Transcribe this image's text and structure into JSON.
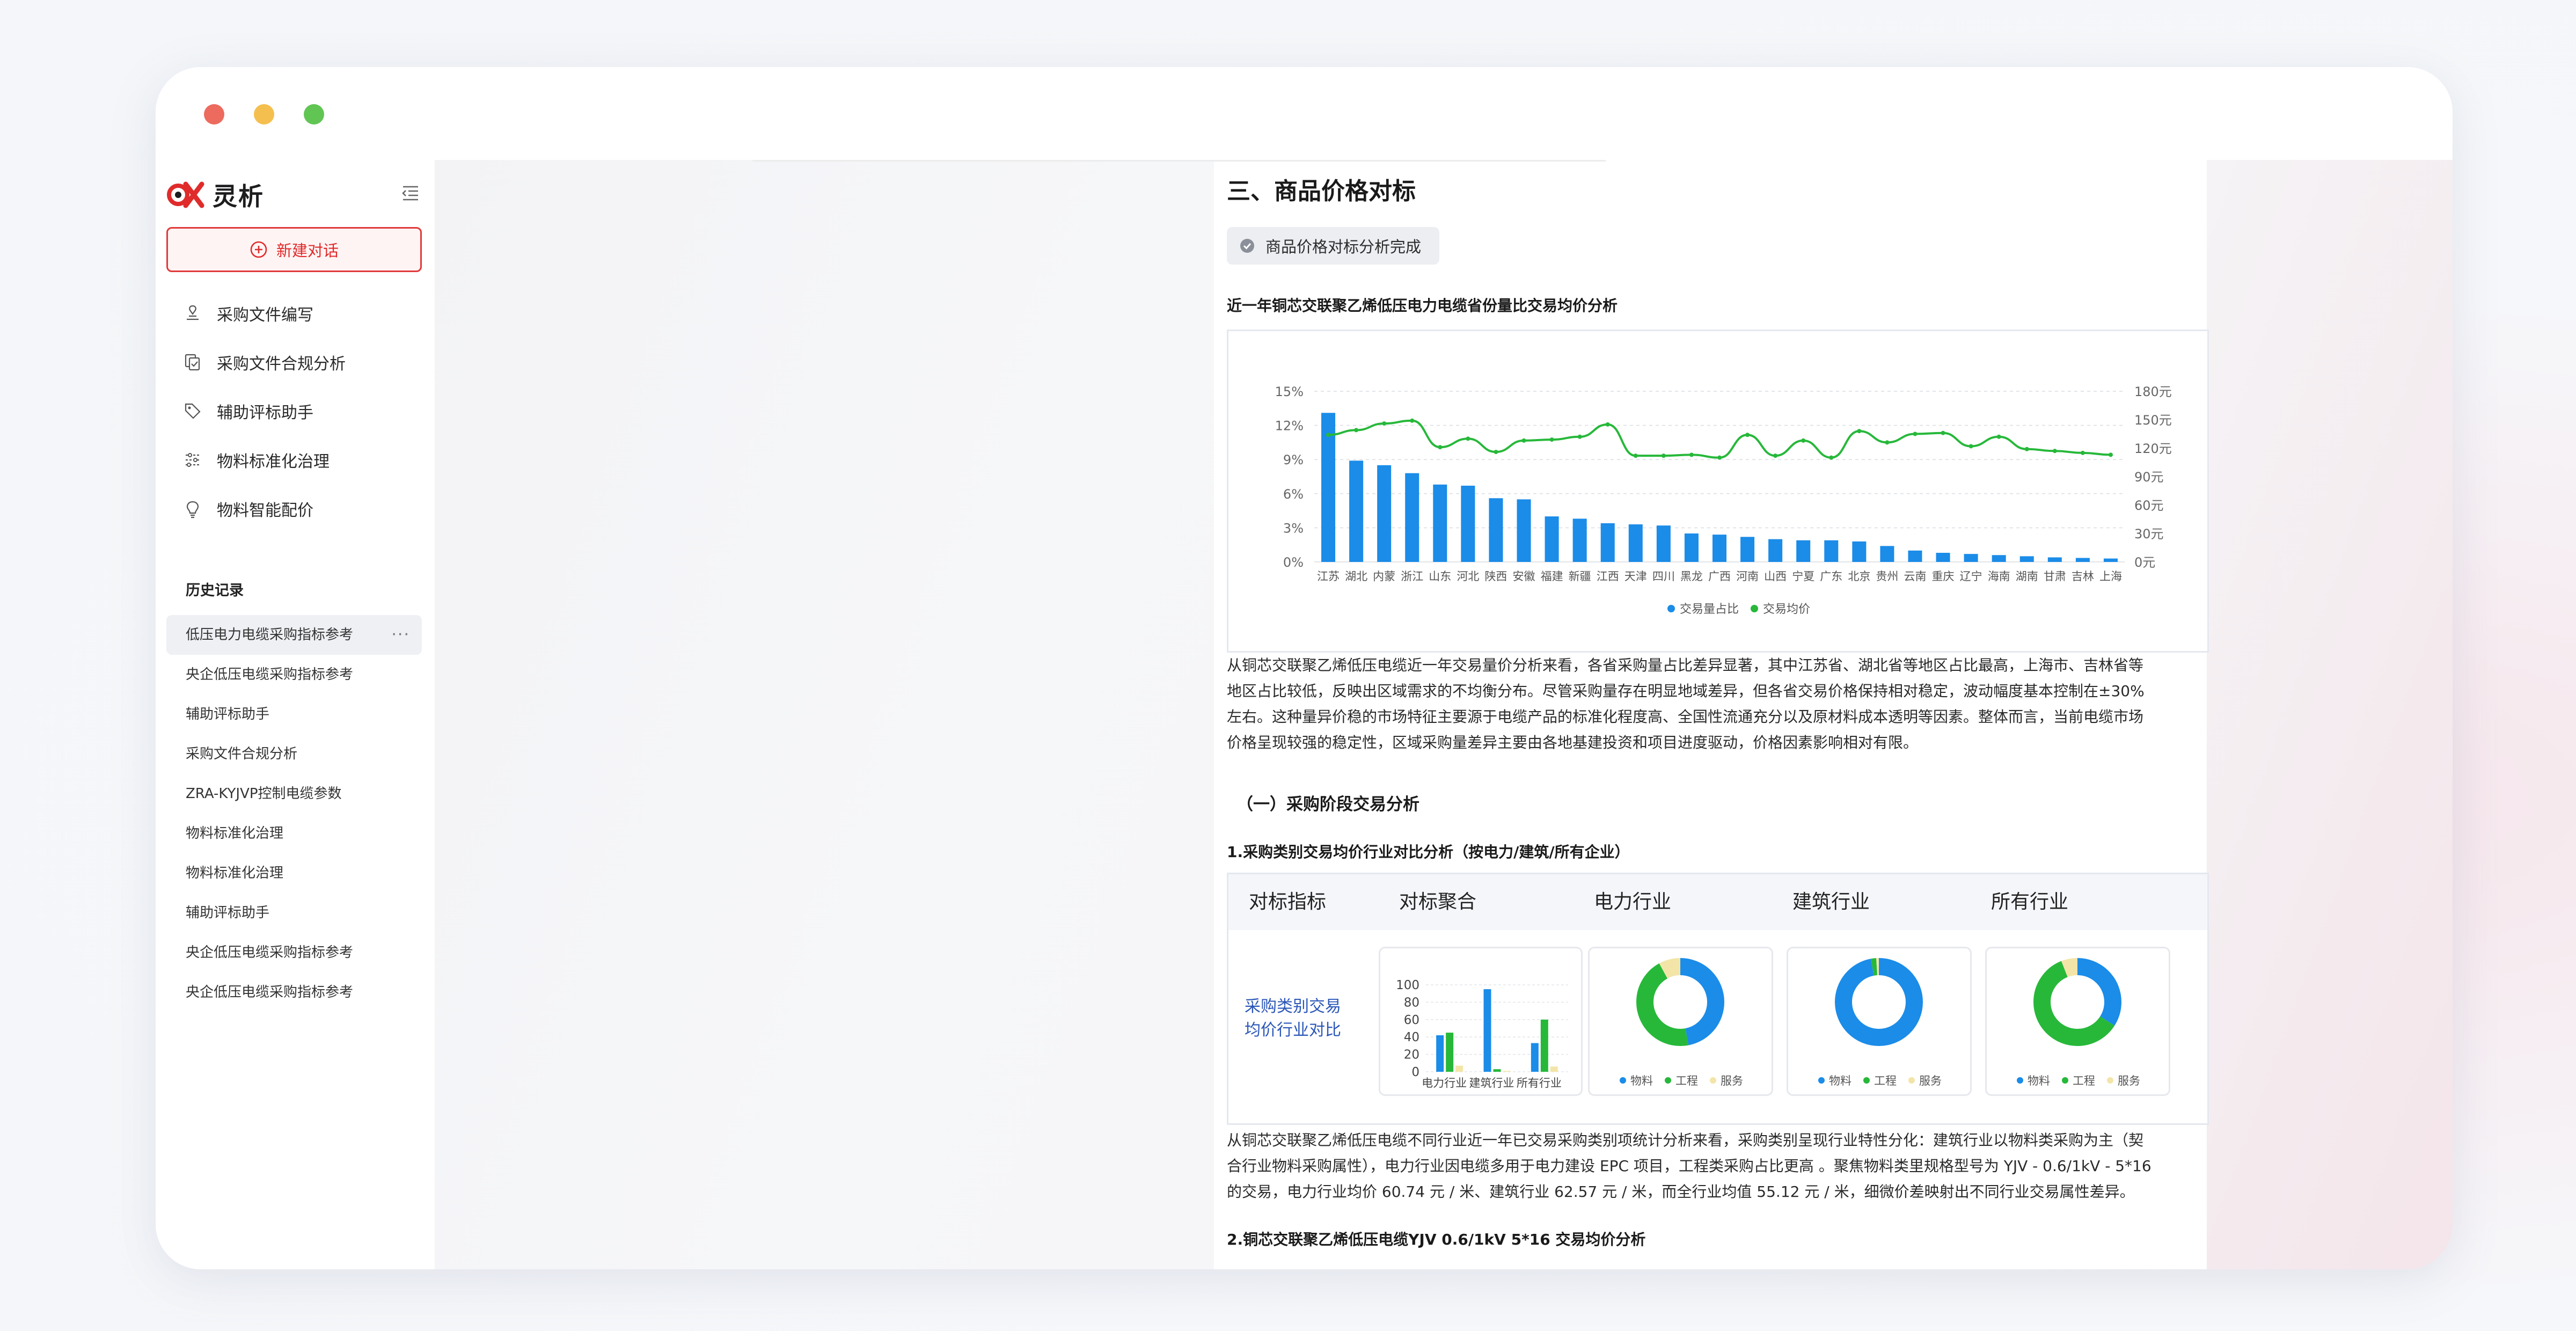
{
  "app": {
    "name": "灵析",
    "new_chat": "新建对话"
  },
  "colors": {
    "accent": "#e02b2b",
    "bar": "#1b8ce8",
    "line": "#27b83a",
    "service": "#f3e5a8"
  },
  "nav": [
    {
      "label": "采购文件编写",
      "icon": "doc-edit-icon"
    },
    {
      "label": "采购文件合规分析",
      "icon": "copy-check-icon"
    },
    {
      "label": "辅助评标助手",
      "icon": "tag-icon"
    },
    {
      "label": "物料标准化治理",
      "icon": "sliders-icon"
    },
    {
      "label": "物料智能配价",
      "icon": "bulb-icon"
    }
  ],
  "history": {
    "title": "历史记录",
    "items": [
      "低压电力电缆采购指标参考",
      "央企低压电缆采购指标参考",
      "辅助评标助手",
      "采购文件合规分析",
      "ZRA-KYJVP控制电缆参数",
      "物料标准化治理",
      "物料标准化治理",
      "辅助评标助手",
      "央企低压电缆采购指标参考",
      "央企低压电缆采购指标参考"
    ],
    "more": "···"
  },
  "report": {
    "section_title": "三、商品价格对标",
    "status": "商品价格对标分析完成",
    "chart_title": "近一年铜芯交联聚乙烯低压电力电缆省份量比交易均价分析",
    "analysis_lines": [
      "从铜芯交联聚乙烯低压电缆近一年交易量价分析来看，各省采购量占比差异显著，其中江苏省、湖北省等地区占比最高，上海市、吉林省等",
      "地区占比较低，反映出区域需求的不均衡分布。尽管采购量存在明显地域差异，但各省交易价格保持相对稳定，波动幅度基本控制在±30%",
      "左右。这种量异价稳的市场特征主要源于电缆产品的标准化程度高、全国性流通充分以及原材料成本透明等因素。整体而言，当前电缆市场",
      "价格呈现较强的稳定性，区域采购量差异主要由各地基建投资和项目进度驱动，价格因素影响相对有限。"
    ],
    "stage_title": "（一）采购阶段交易分析",
    "sub1_title": "1.采购类别交易均价行业对比分析（按电力/建筑/所有企业）",
    "table": {
      "headers": [
        "对标指标",
        "对标聚合",
        "电力行业",
        "建筑行业",
        "所有行业"
      ],
      "row_label": "采购类别交易均价行业对比"
    },
    "industry_lines": [
      "从铜芯交联聚乙烯低压电缆不同行业近一年已交易采购类别项统计分析来看，采购类别呈现行业特性分化：建筑行业以物料类采购为主（契",
      "合行业物料采购属性），电力行业因电缆多用于电力建设 EPC 项目，工程类采购占比更高 。聚焦物料类里规格型号为 YJV - 0.6/1kV - 5*16",
      "的交易，电力行业均价 60.74 元 / 米、建筑行业 62.57 元 / 米，而全行业均值 55.12 元 / 米，细微价差映射出不同行业交易属性差异。"
    ],
    "sub2_title": "2.铜芯交联聚乙烯低压电缆YJV 0.6/1kV 5*16 交易均价分析"
  },
  "chart_data": [
    {
      "type": "bar+line",
      "title": "",
      "categories": [
        "江苏",
        "湖北",
        "内蒙",
        "浙江",
        "山东",
        "河北",
        "陕西",
        "安徽",
        "福建",
        "新疆",
        "江西",
        "天津",
        "四川",
        "黑龙",
        "广西",
        "河南",
        "山西",
        "宁夏",
        "广东",
        "北京",
        "贵州",
        "云南",
        "重庆",
        "辽宁",
        "海南",
        "湖南",
        "甘肃",
        "吉林",
        "上海"
      ],
      "series": [
        {
          "name": "交易量占比",
          "type": "bar",
          "axis": "left",
          "values": [
            13.1,
            8.9,
            8.5,
            7.8,
            6.8,
            6.7,
            5.6,
            5.5,
            4.0,
            3.8,
            3.4,
            3.3,
            3.2,
            2.5,
            2.4,
            2.2,
            2.0,
            1.9,
            1.9,
            1.8,
            1.4,
            1.0,
            0.8,
            0.7,
            0.6,
            0.5,
            0.4,
            0.35,
            0.3
          ]
        },
        {
          "name": "交易均价",
          "type": "line",
          "axis": "right",
          "values": [
            134,
            139,
            146,
            149,
            121,
            130,
            116,
            128,
            129,
            132,
            145,
            112,
            112,
            113,
            110,
            134,
            112,
            128,
            110,
            138,
            126,
            135,
            136,
            122,
            132,
            119,
            117,
            115,
            113
          ]
        }
      ],
      "y_left": {
        "min": 0,
        "max": 15,
        "ticks": [
          "0%",
          "3%",
          "6%",
          "9%",
          "12%",
          "15%"
        ]
      },
      "y_right": {
        "min": 0,
        "max": 180,
        "ticks": [
          "0元",
          "30元",
          "60元",
          "90元",
          "120元",
          "150元",
          "180元"
        ]
      },
      "grid": true,
      "legend": "bottom-center"
    },
    {
      "type": "bar",
      "categories": [
        "电力行业",
        "建筑行业",
        "所有行业"
      ],
      "series": [
        {
          "name": "物料",
          "values": [
            42,
            95,
            33
          ]
        },
        {
          "name": "工程",
          "values": [
            45,
            3,
            60
          ]
        },
        {
          "name": "服务",
          "values": [
            7,
            1,
            6
          ]
        }
      ],
      "y_ticks": [
        "0",
        "20",
        "40",
        "60",
        "80",
        "100"
      ],
      "ylim": [
        0,
        100
      ]
    },
    {
      "type": "pie",
      "categories": [
        "物料",
        "工程",
        "服务"
      ],
      "charts": [
        {
          "industry": "电力行业",
          "values": [
            47,
            45,
            8
          ]
        },
        {
          "industry": "建筑行业",
          "values": [
            97,
            2,
            1
          ]
        },
        {
          "industry": "所有行业",
          "values": [
            34,
            60,
            6
          ]
        }
      ],
      "legend": "bottom-center"
    }
  ]
}
